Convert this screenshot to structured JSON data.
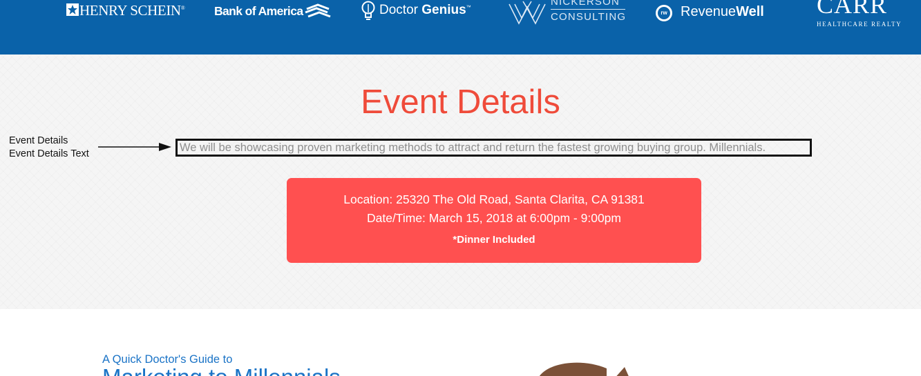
{
  "colors": {
    "logo_bar_bg": "#0a62a9",
    "event_title": "#ef4b3a",
    "event_card_bg": "#ff5050",
    "guide_text": "#1a73c6",
    "illustration_brown": "#7b5138"
  },
  "sponsors": {
    "henry_schein": {
      "name": "HENRY SCHEIN",
      "mark": "®"
    },
    "bank_of_america": {
      "name": "Bank of America"
    },
    "doctor_genius": {
      "name_part1": "Doctor",
      "name_part2": "Genius",
      "mark": "™"
    },
    "nickerson": {
      "line1": "NICKERSON",
      "line2": "CONSULTING"
    },
    "revenuewell": {
      "badge": "rw",
      "name_part1": "Revenue",
      "name_part2": "Well"
    },
    "carr": {
      "name": "CARR",
      "tagline": "HEALTHCARE REALTY"
    }
  },
  "event": {
    "title": "Event Details",
    "text": "We will be showcasing proven marketing methods to attract and return the fastest growing buying group. Millennials.",
    "location": "Location: 25320 The Old Road, Santa Clarita, CA 91381",
    "datetime": "Date/Time: March 15, 2018 at 6:00pm - 9:00pm",
    "dinner": "*Dinner Included"
  },
  "annotation": {
    "line1": "Event Details",
    "line2": "Event Details Text"
  },
  "guide": {
    "kicker": "A Quick Doctor's Guide to",
    "title": "Marketing to Millennials"
  }
}
